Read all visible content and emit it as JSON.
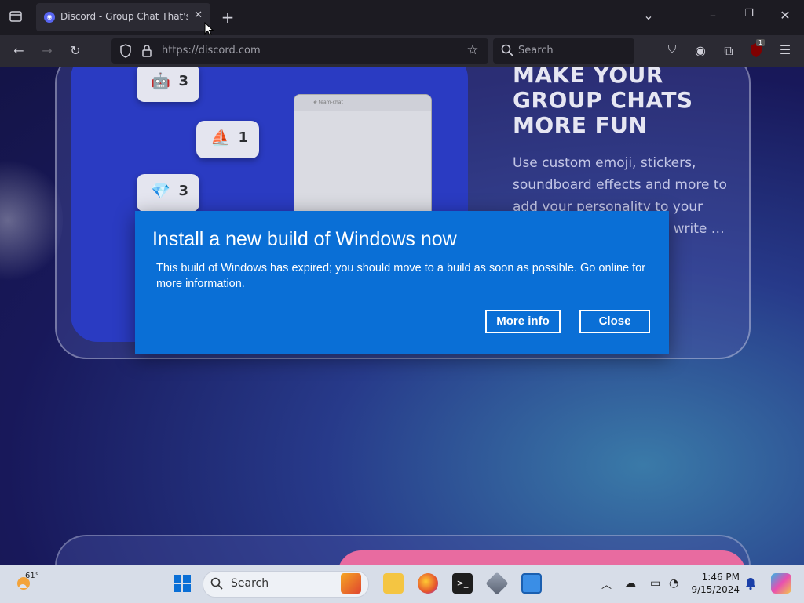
{
  "browser": {
    "tab_title": "Discord - Group Chat That's All Fun & Games",
    "url": "https://discord.com",
    "search_placeholder": "Search",
    "extension_badge": "1"
  },
  "page": {
    "chips": [
      {
        "icon": "robot-emoji-icon",
        "count": "3"
      },
      {
        "icon": "boat-emoji-icon",
        "count": "1"
      },
      {
        "icon": "crystal-emoji-icon",
        "count": "3"
      }
    ],
    "mock_header": "# team-chat",
    "heading": "MAKE YOUR GROUP CHATS MORE FUN",
    "body": "Use custom emoji, stickers, soundboard effects and more to add your personality to your voice, … your avatar … write … up in chat"
  },
  "dialog": {
    "title": "Install a new build of Windows now",
    "message": "This build of Windows has expired; you should move to a build as soon as possible. Go online for more information.",
    "more_info_label": "More info",
    "close_label": "Close"
  },
  "taskbar": {
    "weather_temp": "61°",
    "search_label": "Search",
    "time": "1:46 PM",
    "date": "9/15/2024"
  },
  "colors": {
    "dialog_bg": "#0a6fd6",
    "discord_blurple": "#5865f2",
    "chrome_dark": "#2b2a33"
  }
}
